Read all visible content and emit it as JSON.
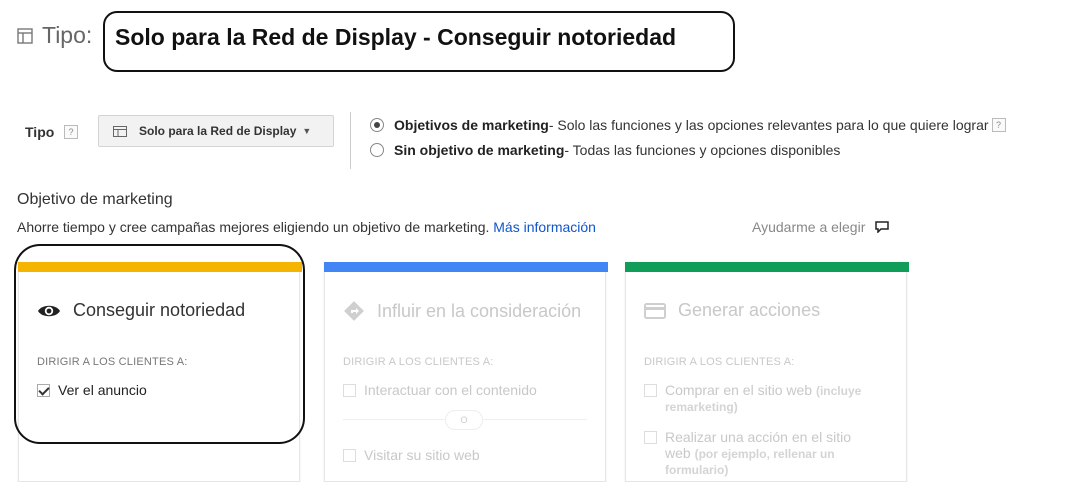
{
  "header": {
    "label": "Tipo:",
    "value": "Solo para la Red de Display - Conseguir notoriedad",
    "icon": "table-icon"
  },
  "type_row": {
    "label": "Tipo",
    "help": "?",
    "dropdown_value": "Solo para la Red de Display",
    "dropdown_icon": "grid-icon",
    "options": [
      {
        "title": "Objetivos de marketing",
        "desc": " - Solo las funciones y las opciones relevantes para lo que quiere lograr",
        "selected": true
      },
      {
        "title": "Sin objetivo de marketing",
        "desc": " - Todas las funciones y opciones disponibles",
        "selected": false
      }
    ]
  },
  "objective": {
    "title": "Objetivo de marketing",
    "desc": "Ahorre tiempo y cree campañas mejores eligiendo un objetivo de marketing. ",
    "link": "Más información",
    "help_choose": "Ayudarme a elegir"
  },
  "cards": [
    {
      "title": "Conseguir notoriedad",
      "icon": "eye-icon",
      "color": "#f4b400",
      "sub": "DIRIGIR A LOS CLIENTES A:",
      "options": [
        {
          "label": "Ver el anuncio",
          "checked": true
        }
      ]
    },
    {
      "title": "Influir en la consideración",
      "icon": "diamond-arrow-icon",
      "color": "#4285f4",
      "sub": "DIRIGIR A LOS CLIENTES A:",
      "options": [
        {
          "label": "Interactuar con el contenido",
          "checked": false
        },
        {
          "label": "Visitar su sitio web",
          "checked": false
        }
      ],
      "or_label": "O"
    },
    {
      "title": "Generar acciones",
      "icon": "card-icon",
      "color": "#0f9d58",
      "sub": "DIRIGIR A LOS CLIENTES A:",
      "options": [
        {
          "label": "Comprar en el sitio web",
          "note": "(incluye",
          "label2": "remarketing)",
          "checked": false
        },
        {
          "label": "Realizar una acción en el sitio",
          "label2": "web",
          "note2": "(por ejemplo, rellenar un",
          "label3": "formulario)",
          "checked": false
        }
      ]
    }
  ]
}
